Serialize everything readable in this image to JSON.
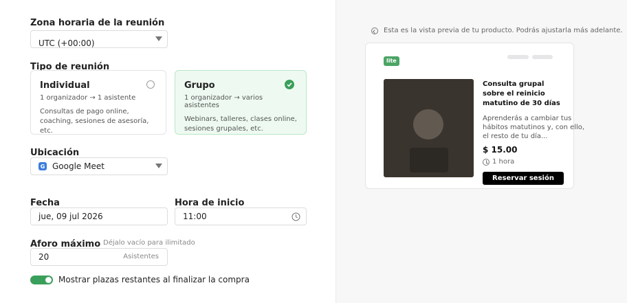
{
  "timezone": {
    "label": "Zona horaria de la reunión",
    "value": "UTC (+00:00)"
  },
  "meeting_type": {
    "label": "Tipo de reunión",
    "options": [
      {
        "title": "Individual",
        "subtitle": "1 organizador → 1 asistente",
        "description": "Consultas de pago online, coaching, sesiones de asesoría, etc.",
        "selected": false
      },
      {
        "title": "Grupo",
        "subtitle": "1 organizador → varios asistentes",
        "description": "Webinars, talleres, clases online, sesiones grupales, etc.",
        "selected": true
      }
    ]
  },
  "location": {
    "label": "Ubicación",
    "value": "Google Meet",
    "icon": "google-meet-icon",
    "icon_text": "G"
  },
  "date": {
    "label": "Fecha",
    "value": "jue, 09 jul 2026"
  },
  "start_time": {
    "label": "Hora de inicio",
    "value": "11:00"
  },
  "capacity": {
    "label": "Aforo máximo",
    "hint": "Déjalo vacío para ilimitado",
    "value": "20",
    "unit": "Asistentes"
  },
  "toggle": {
    "label": "Mostrar plazas restantes al finalizar la compra",
    "on": true
  },
  "preview": {
    "notice": "Esta es la vista previa de tu producto. Podrás ajustarla más adelante.",
    "badge": "lite",
    "title": "Consulta grupal sobre el reinicio matutino de 30 días",
    "description": "Aprenderás a cambiar tus hábitos matutinos y, con ello, el resto de tu día...",
    "price": "$ 15.00",
    "duration": "1 hora",
    "button_label": "Reservar sesión"
  },
  "colors": {
    "accent": "#3a9f5a",
    "selected_bg": "#eefaf1",
    "button": "#000000"
  }
}
